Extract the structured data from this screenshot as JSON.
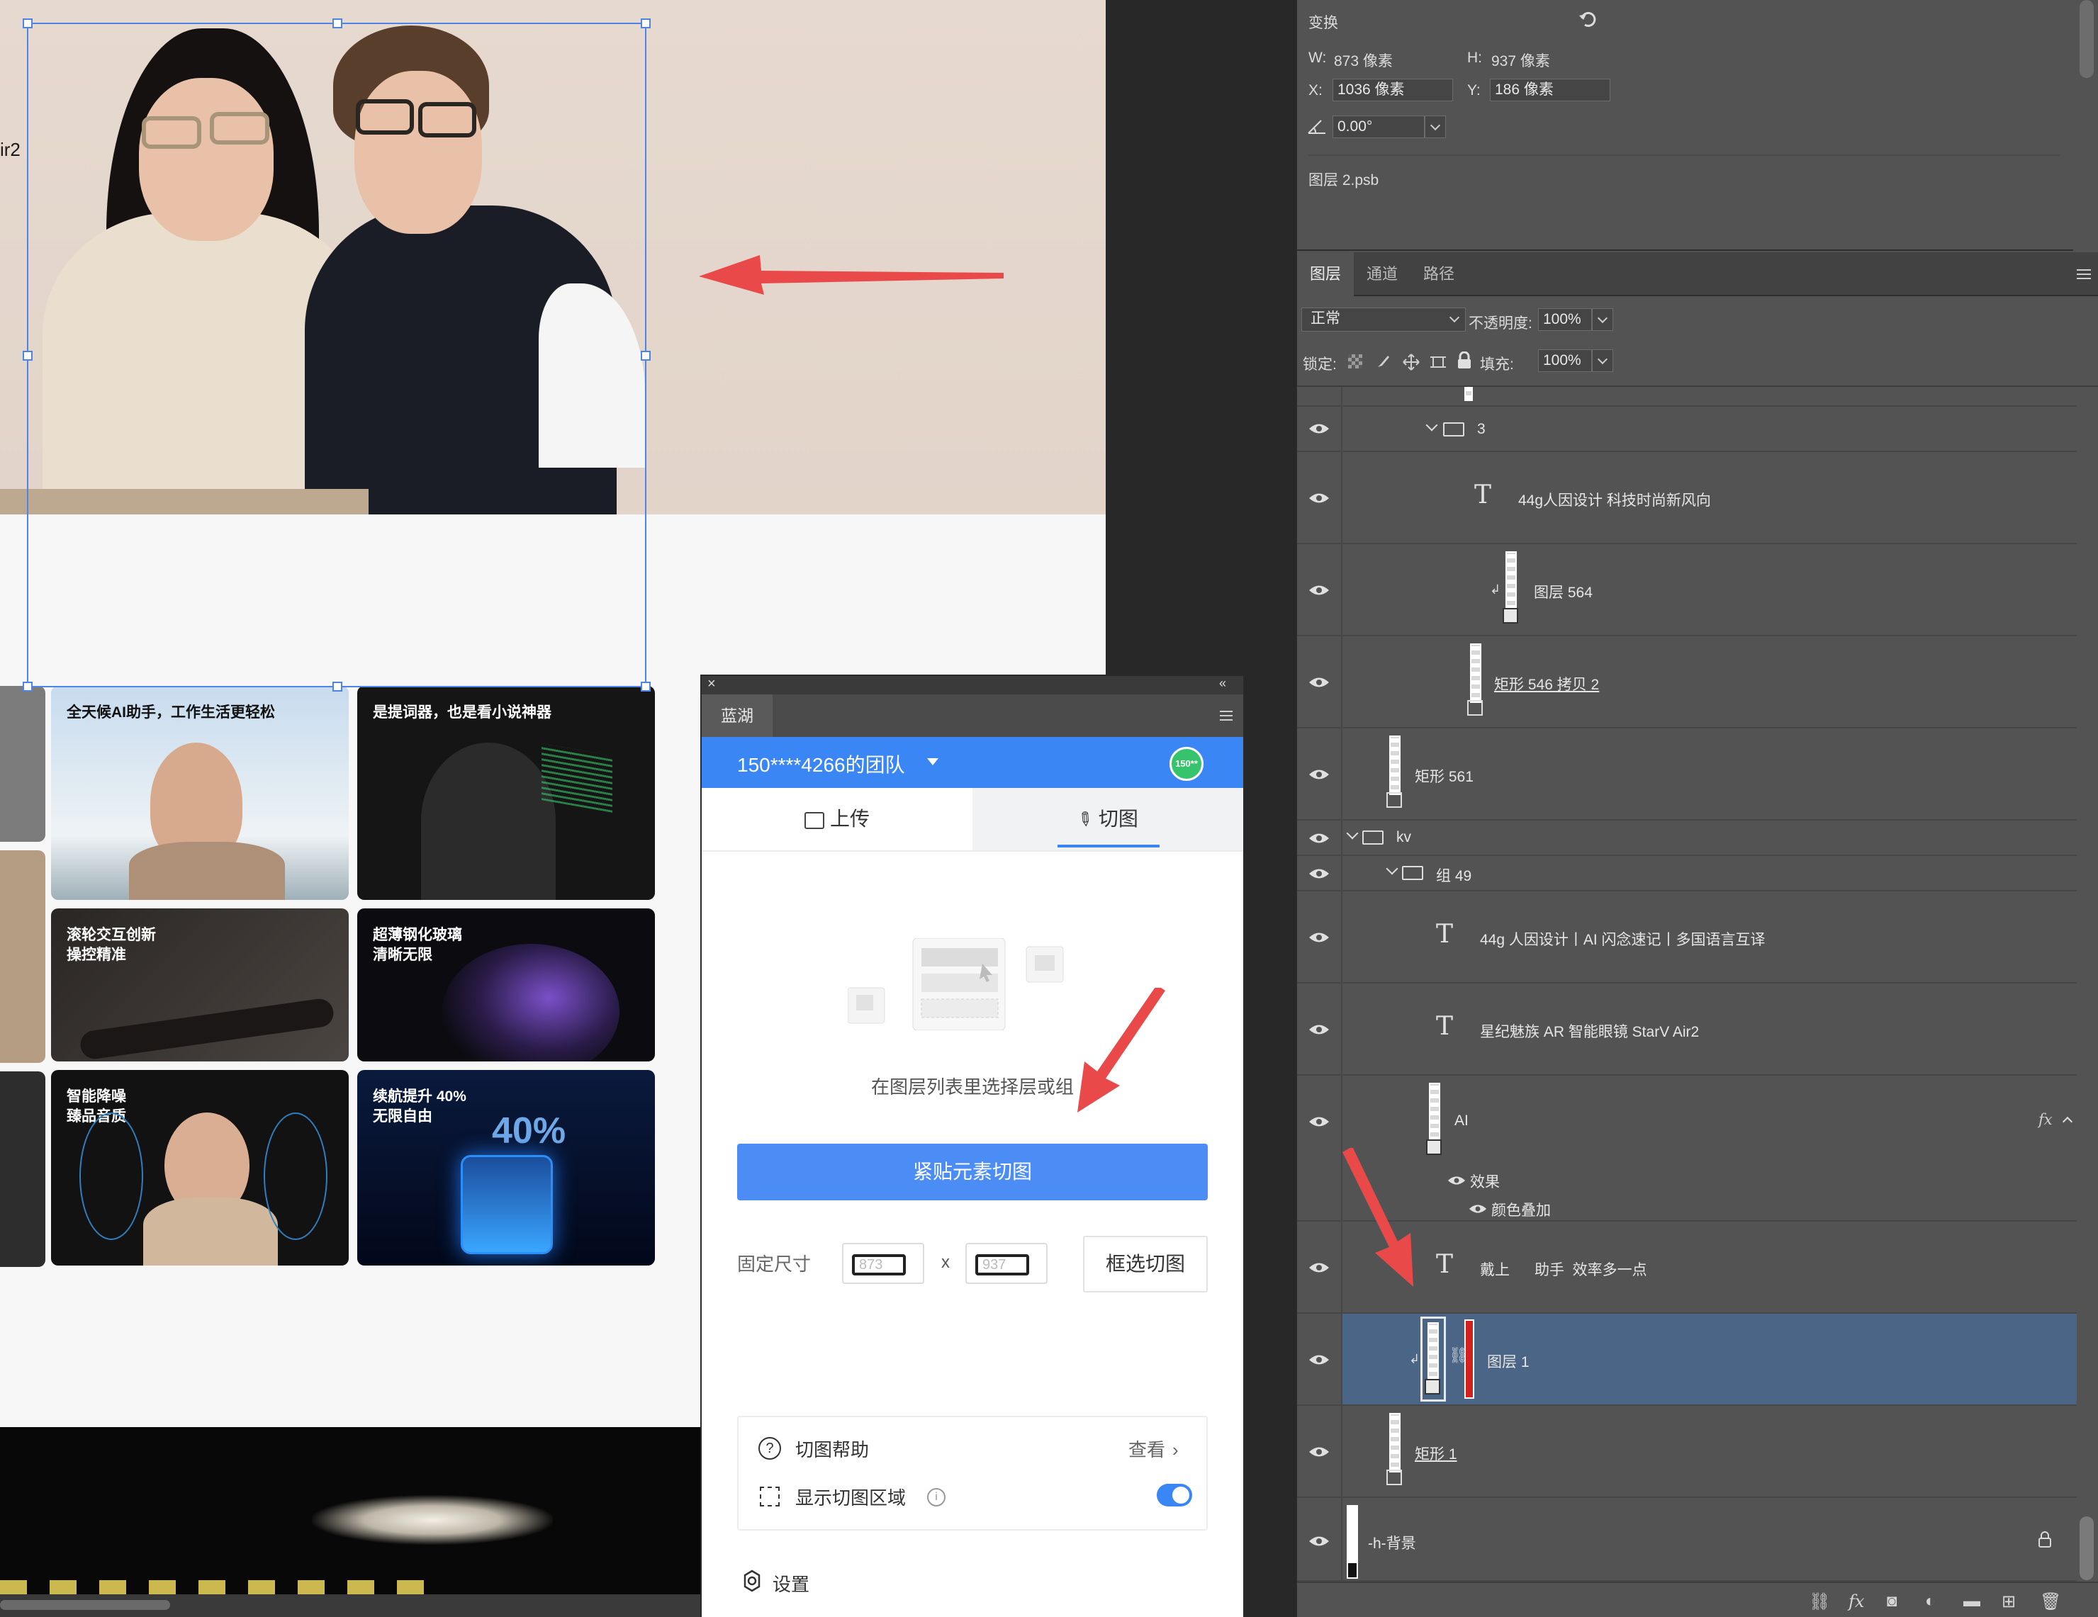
{
  "canvas": {
    "hero_snippet": "ir2",
    "cards": [
      {
        "title": "全天候AI助手，工作生活更轻松"
      },
      {
        "title": "是提词器，也是看小说神器"
      },
      {
        "title": "滚轮交互创新\n操控精准"
      },
      {
        "title": "超薄钢化玻璃\n清晰无限"
      },
      {
        "title": "智能降噪\n臻品音质"
      },
      {
        "title": "续航提升 40%\n无限自由"
      }
    ],
    "battery_badge": "40%"
  },
  "transform": {
    "title": "变换",
    "w_label": "W:",
    "w_value": "873 像素",
    "h_label": "H:",
    "h_value": "937 像素",
    "x_label": "X:",
    "x_value": "1036 像素",
    "y_label": "Y:",
    "y_value": "186 像素",
    "angle_value": "0.00°",
    "file_name": "图层 2.psb"
  },
  "layers_panel": {
    "tabs": [
      "图层",
      "通道",
      "路径"
    ],
    "blend_mode": "正常",
    "opacity_label": "不透明度:",
    "opacity_value": "100%",
    "lock_label": "锁定:",
    "fill_label": "填充:",
    "fill_value": "100%",
    "layers": [
      {
        "name": "3",
        "kind": "group"
      },
      {
        "name": "44g人因设计 科技时尚新风向",
        "kind": "text"
      },
      {
        "name": "图层 564",
        "kind": "smart"
      },
      {
        "name": "矩形 546 拷贝 2",
        "kind": "shape"
      },
      {
        "name": "矩形 561",
        "kind": "shape"
      },
      {
        "name": "kv",
        "kind": "group"
      },
      {
        "name": "组 49",
        "kind": "group"
      },
      {
        "name": "44g 人因设计丨AI 闪念速记丨多国语言互译",
        "kind": "text"
      },
      {
        "name": "星纪魅族 AR 智能眼镜 StarV Air2",
        "kind": "text"
      },
      {
        "name": "AI",
        "kind": "smart",
        "fx": "fx"
      },
      {
        "name": "戴上      助手  效率多一点",
        "kind": "text"
      },
      {
        "name": "图层 1",
        "kind": "smart",
        "selected": true
      },
      {
        "name": "矩形 1",
        "kind": "shape"
      },
      {
        "name": "-h-背景",
        "kind": "bg"
      }
    ],
    "effects_label": "效果",
    "color_overlay_label": "颜色叠加"
  },
  "plugin": {
    "tab_name": "蓝湖",
    "team_name": "150****4266的团队",
    "avatar_text": "150**",
    "nav_upload": "上传",
    "nav_slice": "切图",
    "empty_text": "在图层列表里选择层或组",
    "snap_button": "紧贴元素切图",
    "fixed_size_label": "固定尺寸",
    "width_value": "873",
    "height_value": "937",
    "x_sep": "x",
    "frame_button": "框选切图",
    "help_label": "切图帮助",
    "help_link": "查看",
    "show_area_label": "显示切图区域",
    "settings_label": "设置",
    "accent": "#3a86f5"
  }
}
